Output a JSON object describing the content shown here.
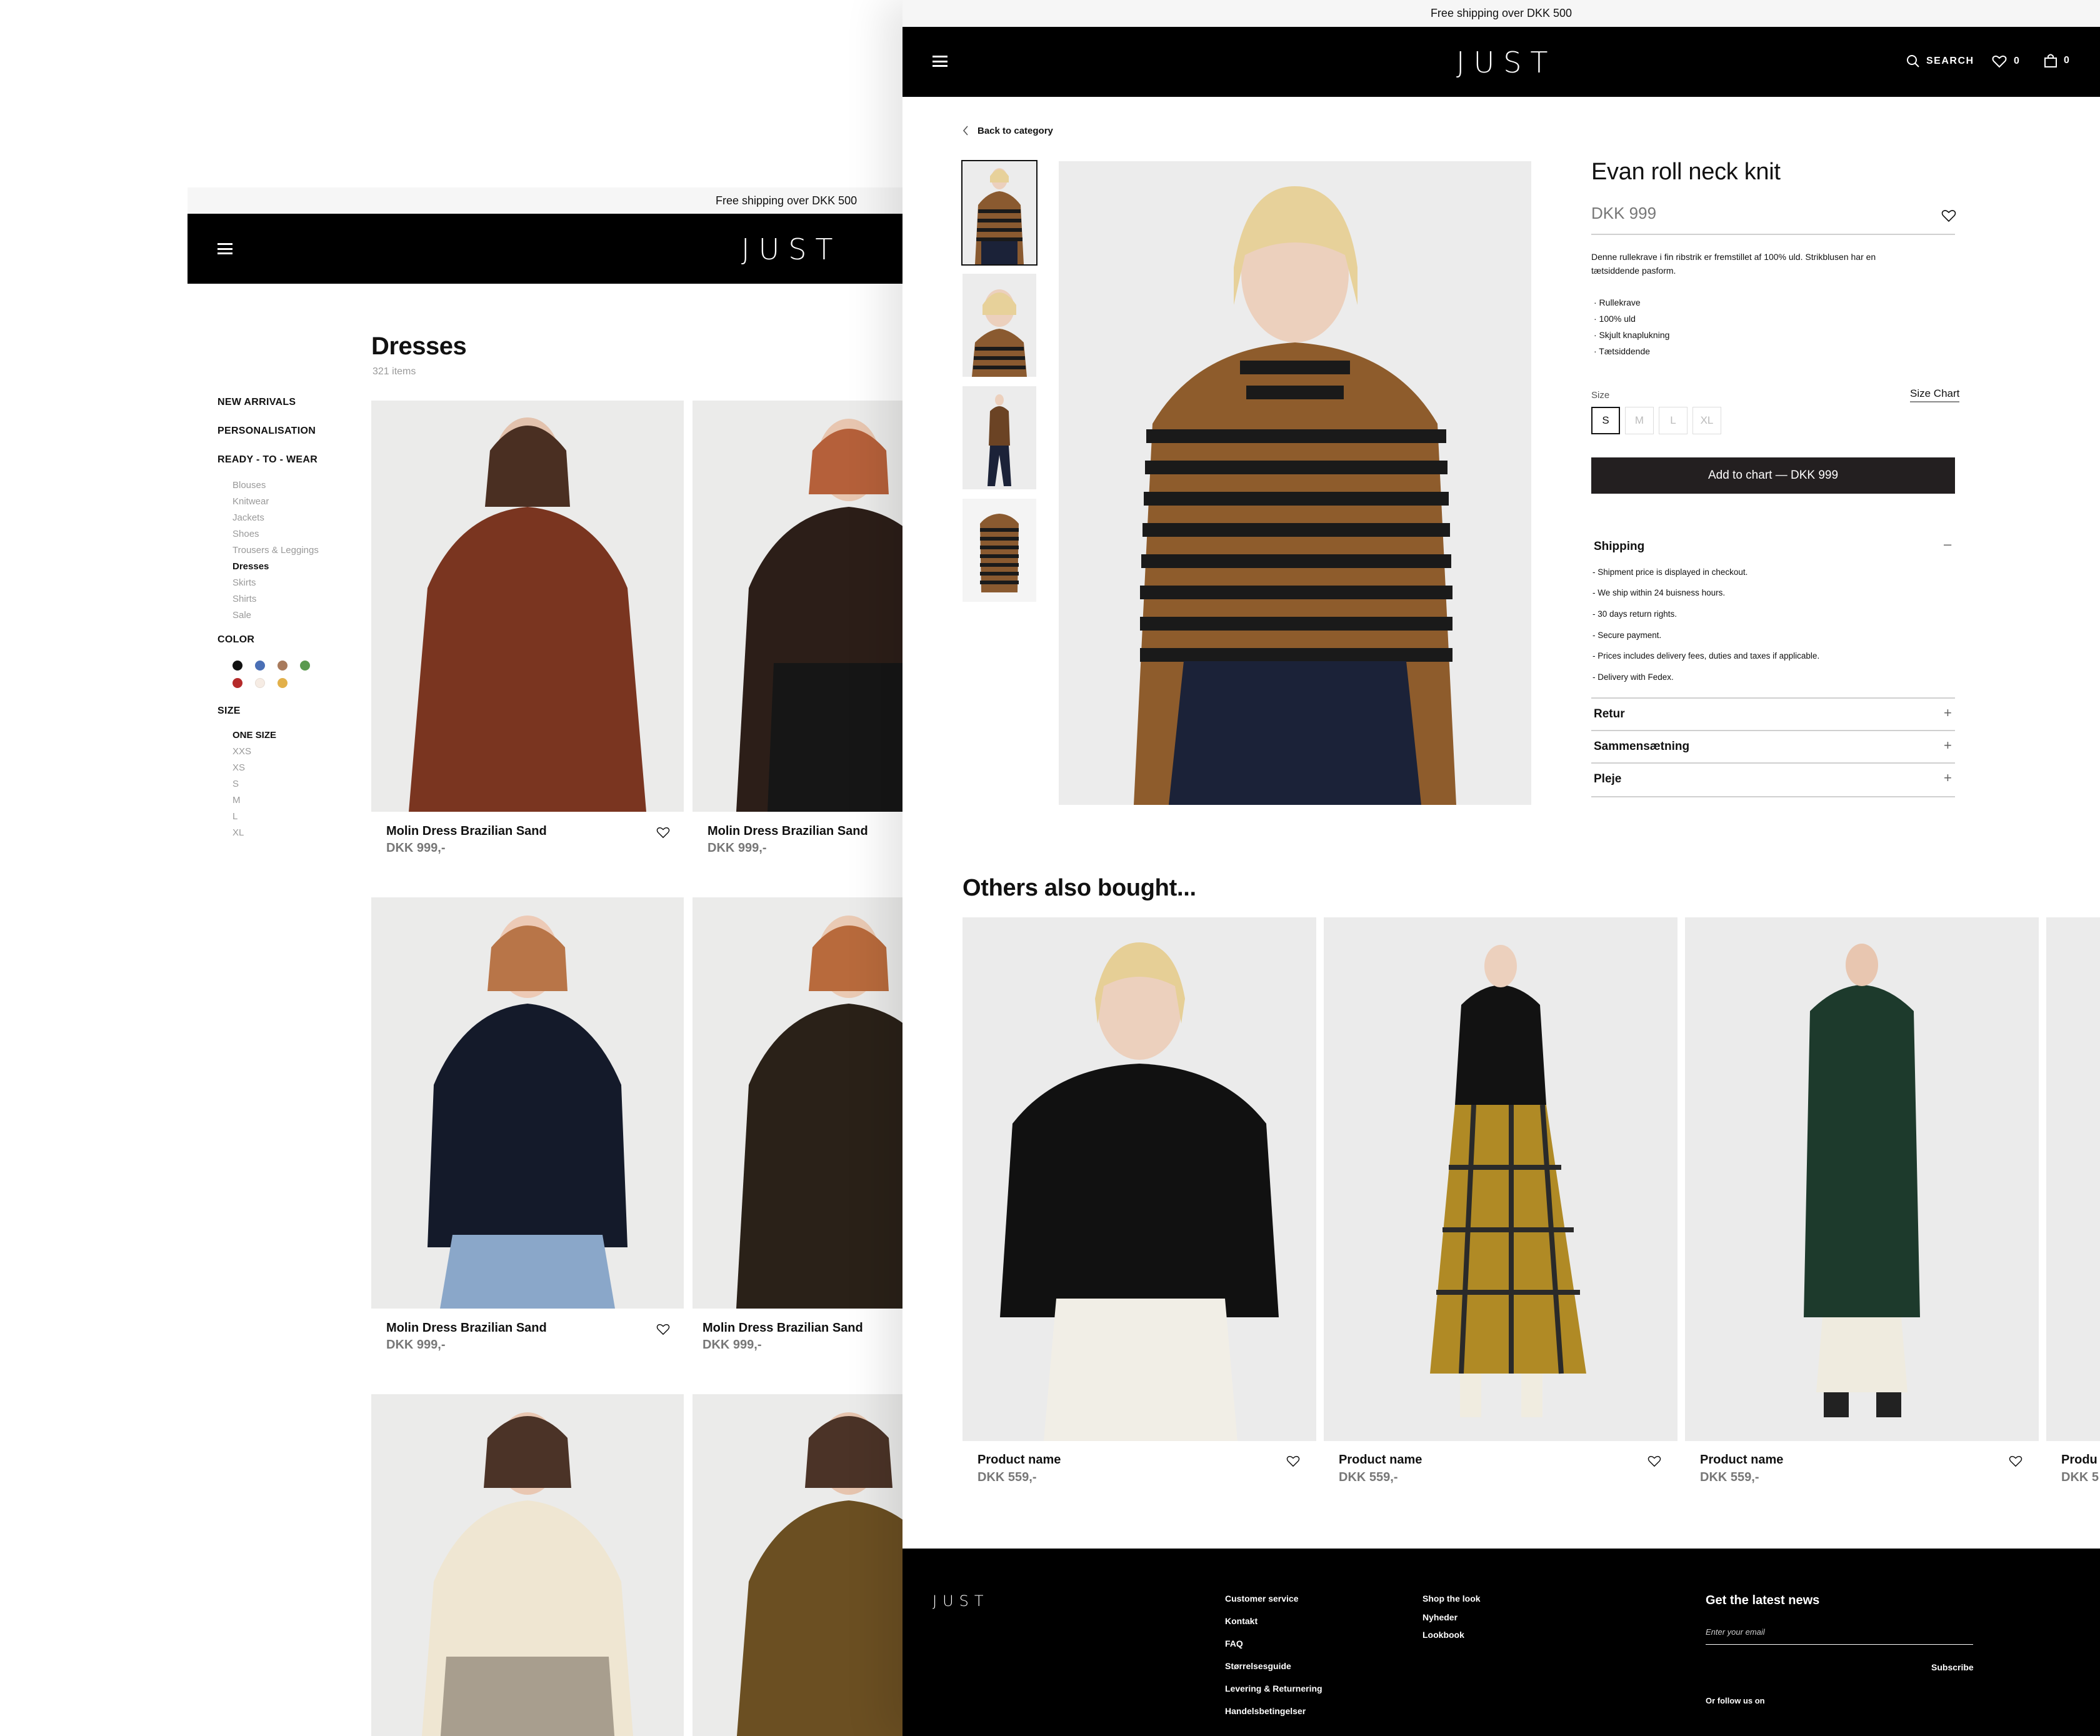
{
  "category_page": {
    "promo": "Free shipping over DKK 500",
    "logo": "JUST",
    "title": "Dresses",
    "count": "321 items",
    "nav_sections": [
      "NEW ARRIVALS",
      "PERSONALISATION",
      "READY - TO - WEAR"
    ],
    "subcategories": [
      "Blouses",
      "Knitwear",
      "Jackets",
      "Shoes",
      "Trousers & Leggings",
      "Dresses",
      "Skirts",
      "Shirts",
      "Sale"
    ],
    "active_subcategory": "Dresses",
    "color_label": "COLOR",
    "colors": [
      "#111111",
      "#4a6fb5",
      "#a87a5c",
      "#5a9a4f",
      "#b52a2a",
      "#f6ece4",
      "#e2b04a"
    ],
    "size_label": "SIZE",
    "sizes": [
      "ONE SIZE",
      "XXS",
      "XS",
      "S",
      "M",
      "L",
      "XL"
    ],
    "products": [
      {
        "name": "Molin Dress Brazilian Sand",
        "price": "DKK 999,-"
      },
      {
        "name": "Molin Dress Brazilian Sand",
        "price": "DKK 999,-"
      },
      {
        "name": "Molin Dress Brazilian Sand",
        "price": "DKK 999,-"
      },
      {
        "name": "Molin Dress Brazilian Sand",
        "price": "DKK 999,-"
      }
    ]
  },
  "product_page": {
    "promo": "Free shipping over DKK 500",
    "logo": "JUST",
    "search_label": "SEARCH",
    "wishlist_count": "0",
    "cart_count": "0",
    "back_label": "Back to category",
    "title": "Evan roll neck knit",
    "price": "DKK 999",
    "description": "Denne rullekrave i fin ribstrik er fremstillet af 100% uld. Strikblusen har en tætsiddende pasform.",
    "bullets": [
      "· Rullekrave",
      "· 100% uld",
      "· Skjult knaplukning",
      "· Tætsiddende"
    ],
    "size_label": "Size",
    "size_chart_label": "Size Chart",
    "sizes": [
      "S",
      "M",
      "L",
      "XL"
    ],
    "selected_size": "S",
    "add_to_cart": "Add to chart — DKK 999",
    "shipping": {
      "title": "Shipping",
      "toggle": "–",
      "lines": [
        "- Shipment price is displayed in checkout.",
        "- We ship within 24 buisness hours.",
        "- 30 days return rights.",
        "- Secure payment.",
        "- Prices includes delivery fees, duties and taxes if applicable.",
        "- Delivery with Fedex."
      ]
    },
    "accordions": [
      {
        "title": "Retur",
        "toggle": "+"
      },
      {
        "title": "Sammensætning",
        "toggle": "+"
      },
      {
        "title": "Pleje",
        "toggle": "+"
      }
    ],
    "others_title": "Others also bought...",
    "recommendations": [
      {
        "name": "Product name",
        "price": "DKK 559,-"
      },
      {
        "name": "Product name",
        "price": "DKK 559,-"
      },
      {
        "name": "Product name",
        "price": "DKK 559,-"
      },
      {
        "name": "Produ",
        "price": "DKK 5"
      }
    ],
    "footer": {
      "logo": "JUST",
      "col1": [
        "Customer service",
        "Kontakt",
        "FAQ",
        "Størrelsesguide",
        "Levering & Returnering",
        "Handelsbetingelser"
      ],
      "col2": [
        "Shop the look",
        "Nyheder",
        "Lookbook"
      ],
      "newsletter_title": "Get the latest news",
      "email_placeholder": "Enter your email",
      "subscribe": "Subscribe",
      "follow": "Or follow us on"
    }
  }
}
